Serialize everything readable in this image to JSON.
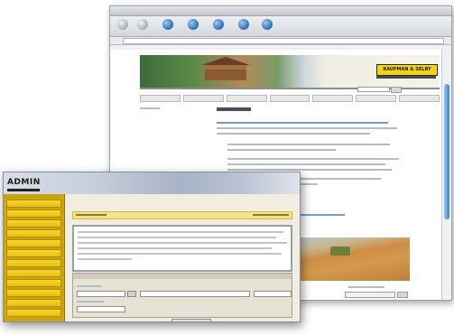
{
  "browser": {
    "title": "",
    "toolbar": [
      {
        "icon": "back-icon",
        "label": ""
      },
      {
        "icon": "forward-icon",
        "label": ""
      },
      {
        "icon": "stop-icon",
        "label": ""
      },
      {
        "icon": "refresh-icon",
        "label": ""
      },
      {
        "icon": "home-icon",
        "label": ""
      },
      {
        "icon": "search-icon",
        "label": ""
      },
      {
        "icon": "favorites-icon",
        "label": ""
      }
    ],
    "logo_text": "KAUFMAN & SELBY"
  },
  "admin": {
    "logo_text": "ADMIN"
  },
  "colors": {
    "sidebar": "#c9a512",
    "sidebar_item": "#f0cc1e",
    "title_bar": "#f4e28c",
    "logo_bg": "#f2d31a",
    "scroll_thumb": "#3f84cf"
  }
}
